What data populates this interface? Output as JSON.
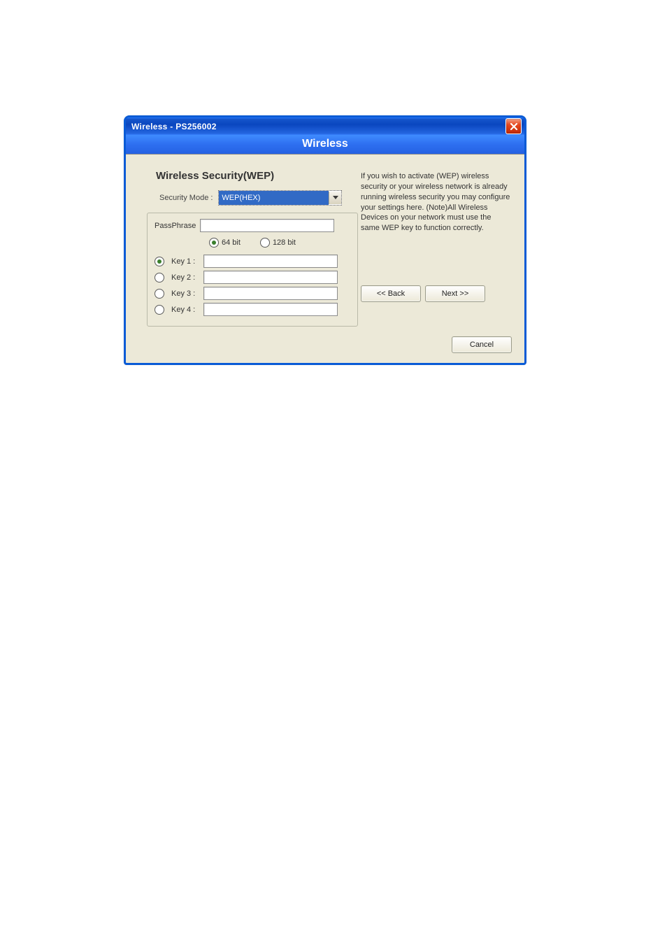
{
  "titlebar": {
    "text": "Wireless - PS256002"
  },
  "subheader": "Wireless",
  "section_title": "Wireless Security(WEP)",
  "security_mode": {
    "label": "Security Mode :",
    "value": "WEP(HEX)"
  },
  "passphrase": {
    "label": "PassPhrase",
    "value": ""
  },
  "bits": {
    "opt1": "64 bit",
    "opt2": "128 bit",
    "selected": "64 bit"
  },
  "keys": {
    "k1": {
      "label": "Key 1 :",
      "value": ""
    },
    "k2": {
      "label": "Key 2 :",
      "value": ""
    },
    "k3": {
      "label": "Key 3 :",
      "value": ""
    },
    "k4": {
      "label": "Key 4 :",
      "value": ""
    },
    "selected": "k1"
  },
  "help_text": "If you wish to activate (WEP) wireless security or your wireless network is already running wireless security you may configure your settings here. (Note)All Wireless Devices on your network must use the same WEP key to function correctly.",
  "buttons": {
    "back": "<< Back",
    "next": "Next >>",
    "cancel": "Cancel"
  }
}
